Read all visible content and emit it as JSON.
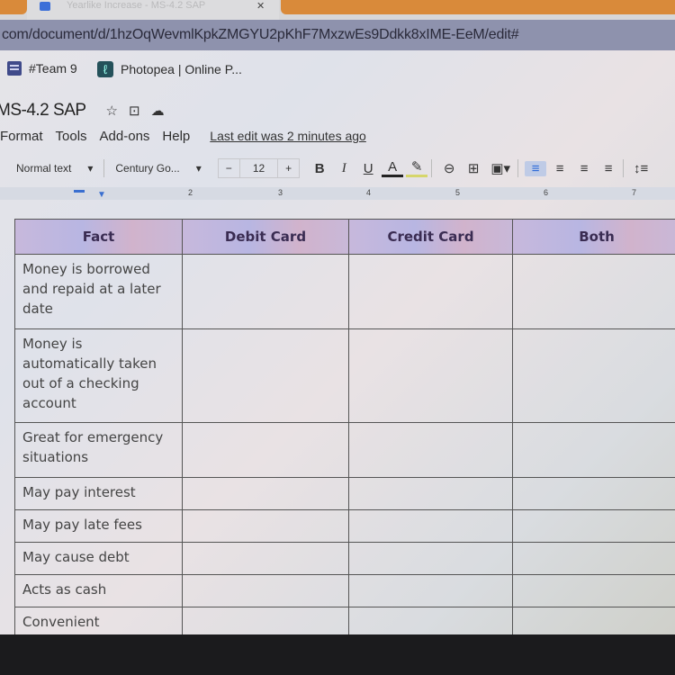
{
  "browser": {
    "active_tab_title": "Yearlike Increase - MS-4.2 SAP",
    "url": "com/document/d/1hzOqWevmlKpkZMGYU2pKhF7MxzwEs9Ddkk8xIME-EeM/edit#",
    "bookmarks": [
      {
        "label": "#Team 9",
        "icon": "team-icon"
      },
      {
        "label": "Photopea | Online P...",
        "icon": "photopea-icon"
      }
    ]
  },
  "document": {
    "title": "MS-4.2 SAP",
    "title_icons": [
      "star-icon",
      "move-to-folder-icon",
      "cloud-saved-icon"
    ],
    "menu": [
      "Format",
      "Tools",
      "Add-ons",
      "Help"
    ],
    "last_edit": "Last edit was 2 minutes ago"
  },
  "toolbar": {
    "style": "Normal text",
    "font": "Century Go...",
    "font_size": "12",
    "minus": "−",
    "plus": "+",
    "bold": "B",
    "italic": "I",
    "underline": "U",
    "text_color": "A",
    "highlight": "✎",
    "link": "⊖",
    "comment": "⊞",
    "image": "▣▾",
    "align_left": "≡",
    "align_center": "≡",
    "align_right": "≡",
    "justify": "≡",
    "line_spacing": "↕≡"
  },
  "ruler": {
    "marks": [
      "2",
      "3",
      "4",
      "5",
      "6",
      "7"
    ]
  },
  "table": {
    "headers": [
      "Fact",
      "Debit Card",
      "Credit Card",
      "Both"
    ],
    "rows": [
      {
        "fact": "Money is borrowed and repaid at a later date",
        "debit": "",
        "credit": "",
        "both": ""
      },
      {
        "fact": "Money is automatically taken out of a checking account",
        "debit": "",
        "credit": "",
        "both": ""
      },
      {
        "fact": "Great for emergency situations",
        "debit": "",
        "credit": "",
        "both": ""
      },
      {
        "fact": "May pay interest",
        "debit": "",
        "credit": "",
        "both": ""
      },
      {
        "fact": "May pay late fees",
        "debit": "",
        "credit": "",
        "both": ""
      },
      {
        "fact": "May cause debt",
        "debit": "",
        "credit": "",
        "both": ""
      },
      {
        "fact": "Acts as cash",
        "debit": "",
        "credit": "",
        "both": ""
      },
      {
        "fact": "Convenient",
        "debit": "",
        "credit": "",
        "both": ""
      }
    ]
  },
  "colors": {
    "header_bg": "#c3b7dd",
    "header_text": "#3a2c52",
    "accent_blue": "#2d6ad8",
    "tab_orange": "#d98a3a"
  }
}
